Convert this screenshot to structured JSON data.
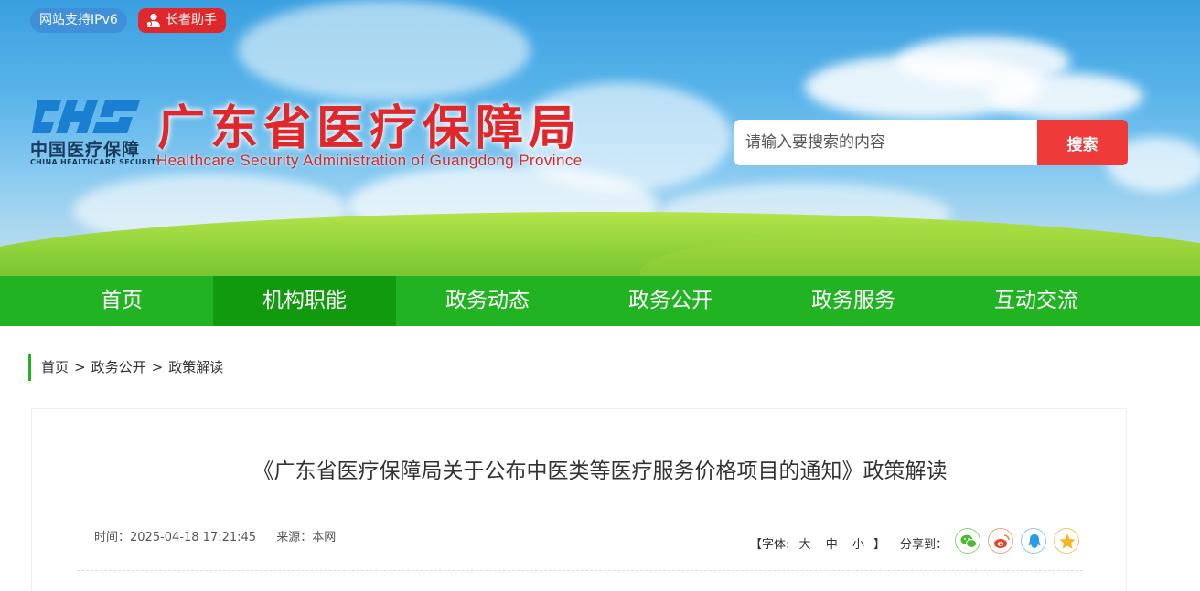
{
  "header": {
    "ipv6_badge": "网站支持IPv6",
    "elder_badge": "长者助手",
    "logo_text_cn": "中国医疗保障",
    "logo_text_en": "CHINA HEALTHCARE SECURITY",
    "site_name_cn": "广东省医疗保障局",
    "site_name_en": "Healthcare Security Administration of Guangdong Province",
    "search": {
      "placeholder": "请输入要搜索的内容",
      "button_label": "搜索"
    }
  },
  "nav": {
    "items": [
      {
        "label": "首页"
      },
      {
        "label": "机构职能"
      },
      {
        "label": "政务动态"
      },
      {
        "label": "政务公开"
      },
      {
        "label": "政务服务"
      },
      {
        "label": "互动交流"
      }
    ],
    "active_label": "机构职能"
  },
  "breadcrumb": {
    "items": [
      "首页",
      "政务公开",
      "政策解读"
    ],
    "separator": ">"
  },
  "article": {
    "title": "《广东省医疗保障局关于公布中医类等医疗服务价格项目的通知》政策解读",
    "time": "时间：2025-04-18 17:21:45",
    "source": "来源：本网",
    "font_size_label_open": "【字体:",
    "font_large": "大",
    "font_medium": "中",
    "font_small": "小",
    "font_size_label_close": "】",
    "share_label": "分享到："
  },
  "colors": {
    "nav_green": "#22b322",
    "nav_active": "#119a0d",
    "brand_red": "#e0282c",
    "search_button": "#ef3a3a"
  },
  "icons": [
    "user-help-icon",
    "wechat-icon",
    "weibo-icon",
    "qq-icon",
    "qzone-icon"
  ]
}
